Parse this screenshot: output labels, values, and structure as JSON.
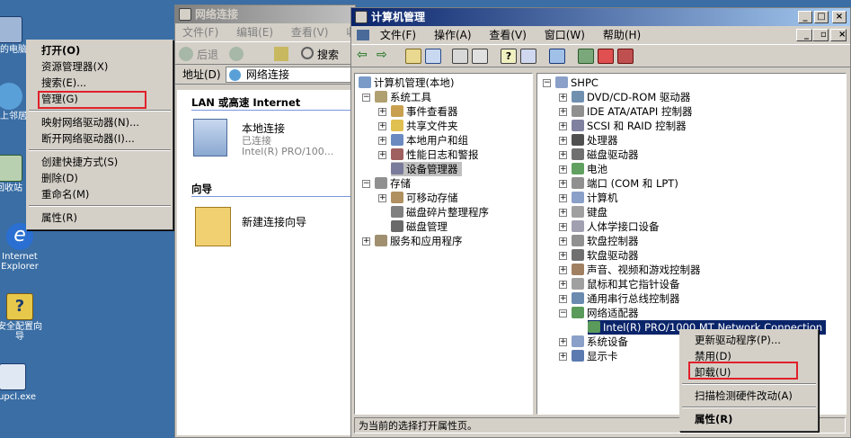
{
  "desktop": {
    "icons": [
      {
        "label": "我的电脑"
      },
      {
        "label": "网上邻居"
      },
      {
        "label": "回收站"
      },
      {
        "label": "Internet Explorer"
      },
      {
        "label": "安全配置向导"
      },
      {
        "label": "etupcl.exe"
      }
    ]
  },
  "desktop_menu": {
    "items": [
      "打开(O)",
      "资源管理器(X)",
      "搜索(E)...",
      "管理(G)",
      "映射网络驱动器(N)...",
      "断开网络驱动器(I)...",
      "创建快捷方式(S)",
      "删除(D)",
      "重命名(M)",
      "属性(R)"
    ]
  },
  "netconn": {
    "title": "网络连接",
    "menu": [
      "文件(F)",
      "编辑(E)",
      "查看(V)",
      "收"
    ],
    "back_label": "后退",
    "search_label": "搜索",
    "address_label": "地址(D)",
    "address_value": "网络连接",
    "section_lan": "LAN 或高速 Internet",
    "conn_name": "本地连接",
    "conn_status": "已连接",
    "conn_device": "Intel(R) PRO/100...",
    "section_wizard": "向导",
    "wizard_name": "新建连接向导"
  },
  "compmgmt": {
    "title": "计算机管理",
    "menu": [
      "文件(F)",
      "操作(A)",
      "查看(V)",
      "窗口(W)",
      "帮助(H)"
    ],
    "left_tree": [
      "计算机管理(本地)",
      "系统工具",
      "事件查看器",
      "共享文件夹",
      "本地用户和组",
      "性能日志和警报",
      "设备管理器",
      "存储",
      "可移动存储",
      "磁盘碎片整理程序",
      "磁盘管理",
      "服务和应用程序"
    ],
    "device_root": "SHPC",
    "devices": [
      "DVD/CD-ROM 驱动器",
      "IDE ATA/ATAPI 控制器",
      "SCSI 和 RAID 控制器",
      "处理器",
      "磁盘驱动器",
      "电池",
      "端口 (COM 和 LPT)",
      "计算机",
      "键盘",
      "人体学接口设备",
      "软盘控制器",
      "软盘驱动器",
      "声音、视频和游戏控制器",
      "鼠标和其它指针设备",
      "通用串行总线控制器",
      "网络适配器",
      "系统设备",
      "显示卡"
    ],
    "network_child": "Intel(R) PRO/1000 MT Network Connection",
    "status": "为当前的选择打开属性页。"
  },
  "device_menu": {
    "items": [
      "更新驱动程序(P)...",
      "禁用(D)",
      "卸载(U)",
      "扫描检测硬件改动(A)",
      "属性(R)"
    ]
  },
  "colors": {
    "title_active": "#0a246a",
    "desktop": "#3a6ea5",
    "highlight": "#e0202a"
  }
}
